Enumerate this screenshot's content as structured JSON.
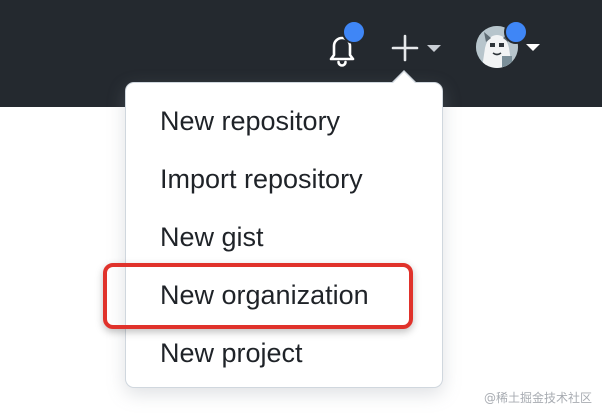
{
  "header": {
    "icons": [
      "bell-icon",
      "plus-icon",
      "caret-down-icon",
      "avatar-image"
    ],
    "background": "#24292f",
    "notification_dot_color": "#3f86f6"
  },
  "menu": {
    "items": [
      {
        "label": "New repository"
      },
      {
        "label": "Import repository"
      },
      {
        "label": "New gist"
      },
      {
        "label": "New organization",
        "highlighted": true
      },
      {
        "label": "New project"
      }
    ],
    "highlight_color": "#e0322b"
  },
  "watermark": "@稀土掘金技术社区"
}
